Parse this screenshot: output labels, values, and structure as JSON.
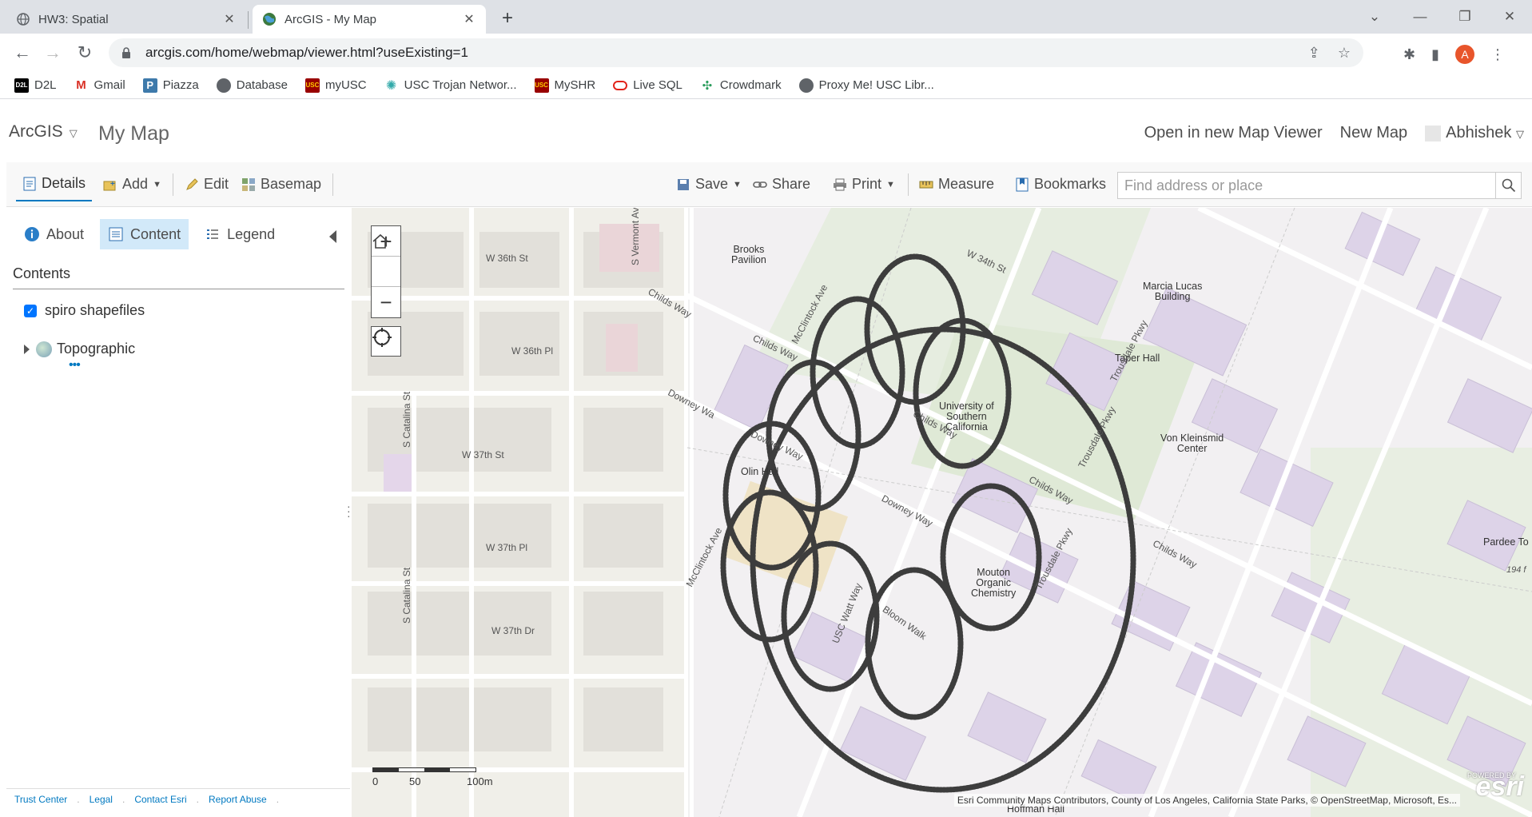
{
  "browser": {
    "tabs": [
      {
        "title": "HW3: Spatial",
        "active": false
      },
      {
        "title": "ArcGIS - My Map",
        "active": true
      }
    ],
    "url": "arcgis.com/home/webmap/viewer.html?useExisting=1",
    "profile_initial": "A",
    "bookmarks": [
      {
        "label": "D2L",
        "icon": "d2l-icon"
      },
      {
        "label": "Gmail",
        "icon": "gmail-icon"
      },
      {
        "label": "Piazza",
        "icon": "piazza-icon"
      },
      {
        "label": "Database",
        "icon": "globe-icon"
      },
      {
        "label": "myUSC",
        "icon": "usc-icon"
      },
      {
        "label": "USC Trojan Networ...",
        "icon": "trojan-network-icon"
      },
      {
        "label": "MySHR",
        "icon": "usc-icon"
      },
      {
        "label": "Live SQL",
        "icon": "oracle-icon"
      },
      {
        "label": "Crowdmark",
        "icon": "crowdmark-icon"
      },
      {
        "label": "Proxy Me! USC Libr...",
        "icon": "globe-icon"
      }
    ]
  },
  "arcgis": {
    "brand": "ArcGIS",
    "map_title": "My Map",
    "header_links": {
      "open_viewer": "Open in new Map Viewer",
      "new_map": "New Map",
      "user": "Abhishek"
    },
    "toolbar": {
      "details": "Details",
      "add": "Add",
      "edit": "Edit",
      "basemap": "Basemap",
      "save": "Save",
      "share": "Share",
      "print": "Print",
      "measure": "Measure",
      "bookmarks": "Bookmarks",
      "search_placeholder": "Find address or place"
    },
    "panel": {
      "tabs": {
        "about": "About",
        "content": "Content",
        "legend": "Legend"
      },
      "contents_heading": "Contents",
      "layers": [
        {
          "name": "spiro shapefiles",
          "checked": true
        },
        {
          "name": "Topographic"
        }
      ],
      "footer": [
        "Trust Center",
        "Legal",
        "Contact Esri",
        "Report Abuse"
      ]
    },
    "map": {
      "scale_labels": [
        "0",
        "50",
        "100m"
      ],
      "attribution": "Esri Community Maps Contributors, County of Los Angeles, California State Parks, © OpenStreetMap, Microsoft, Es...",
      "esri_powered": "POWERED BY",
      "esri_logo": "esri",
      "labels": {
        "w36th_st": "W 36th St",
        "w36th_pl": "W 36th Pl",
        "w37th_st": "W 37th St",
        "w37th_pl": "W 37th Pl",
        "w37th_dr": "W 37th Dr",
        "vermont": "S Vermont Ave",
        "catalina1": "S Catalina St",
        "catalina2": "S Catalina St",
        "w34th": "W 34th St",
        "brooks": "Brooks\nPavilion",
        "marcia": "Marcia Lucas\nBuilding",
        "taper": "Taper Hall",
        "usc": "University of\nSouthern\nCalifornia",
        "vonk": "Von Kleinsmid\nCenter",
        "olin": "Olin Hall",
        "mouton": "Mouton\nOrganic\nChemistry",
        "pardee": "Pardee To",
        "hoffman": "Hoffman Hall",
        "childs1": "Childs Way",
        "childs2": "Childs Way",
        "childs3": "Childs Way",
        "childs4": "Childs Way",
        "childs5": "Childs Way",
        "downey1": "Downey Wa",
        "downey2": "Downey Way",
        "downey3": "Downey Way",
        "mcclintock1": "McClintock Ave",
        "mcclintock2": "McClintock Ave",
        "uscwatt": "USC Watt Way",
        "bloom": "Bloom Walk",
        "trousdale1": "Trousdale Pkwy",
        "trousdale2": "Trousdale Pkwy",
        "trousdale3": "Trousdale Pkwy",
        "elev": "194 f"
      }
    }
  }
}
